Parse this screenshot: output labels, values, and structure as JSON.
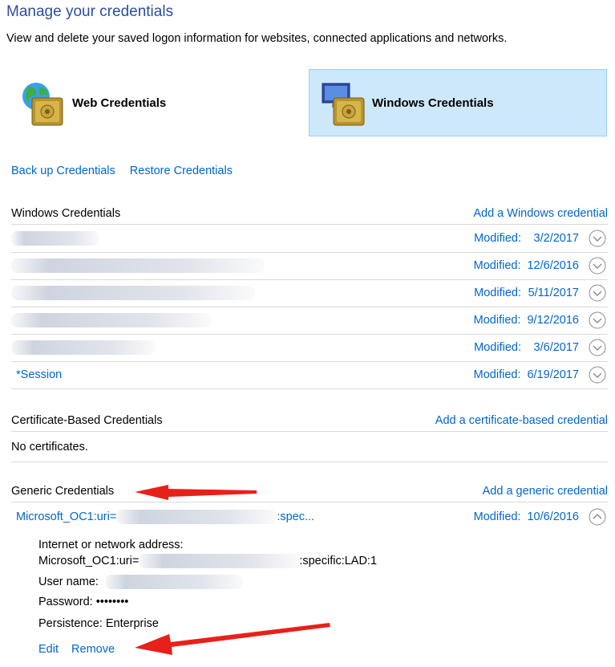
{
  "header": {
    "title": "Manage your credentials",
    "subtitle": "View and delete your saved logon information for websites, connected applications and networks."
  },
  "tiles": {
    "web": {
      "label": "Web Credentials",
      "icon": "web-credentials-vault-icon"
    },
    "windows": {
      "label": "Windows Credentials",
      "icon": "windows-credentials-vault-icon",
      "selected": true
    }
  },
  "actions": {
    "backup": "Back up Credentials",
    "restore": "Restore Credentials"
  },
  "windows_section": {
    "heading": "Windows Credentials",
    "add": "Add a Windows credential",
    "rows": [
      {
        "name": "",
        "modified_label": "Modified:",
        "date": "3/2/2017"
      },
      {
        "name": "",
        "modified_label": "Modified:",
        "date": "12/6/2016"
      },
      {
        "name": "",
        "modified_label": "Modified:",
        "date": "5/11/2017"
      },
      {
        "name": "",
        "modified_label": "Modified:",
        "date": "9/12/2016"
      },
      {
        "name": "",
        "modified_label": "Modified:",
        "date": "3/6/2017"
      },
      {
        "name": "*Session",
        "modified_label": "Modified:",
        "date": "6/19/2017"
      }
    ]
  },
  "cert_section": {
    "heading": "Certificate-Based Credentials",
    "add": "Add a certificate-based credential",
    "empty": "No certificates."
  },
  "generic_section": {
    "heading": "Generic Credentials",
    "add": "Add a generic credential",
    "entry": {
      "name_prefix": "Microsoft_OC1:uri=",
      "name_suffix": ":spec...",
      "modified_label": "Modified:",
      "date": "10/6/2016",
      "address_label": "Internet or network address:",
      "address_prefix": "Microsoft_OC1:uri=",
      "address_suffix": ":specific:LAD:1",
      "username_label": "User name:",
      "password_label": "Password:",
      "password_value": "••••••••",
      "persistence_label": "Persistence:",
      "persistence_value": "Enterprise",
      "edit": "Edit",
      "remove": "Remove"
    }
  },
  "colors": {
    "link": "#0066cc",
    "selected_tile": "#cde8fb",
    "arrow": "#e8201a"
  }
}
